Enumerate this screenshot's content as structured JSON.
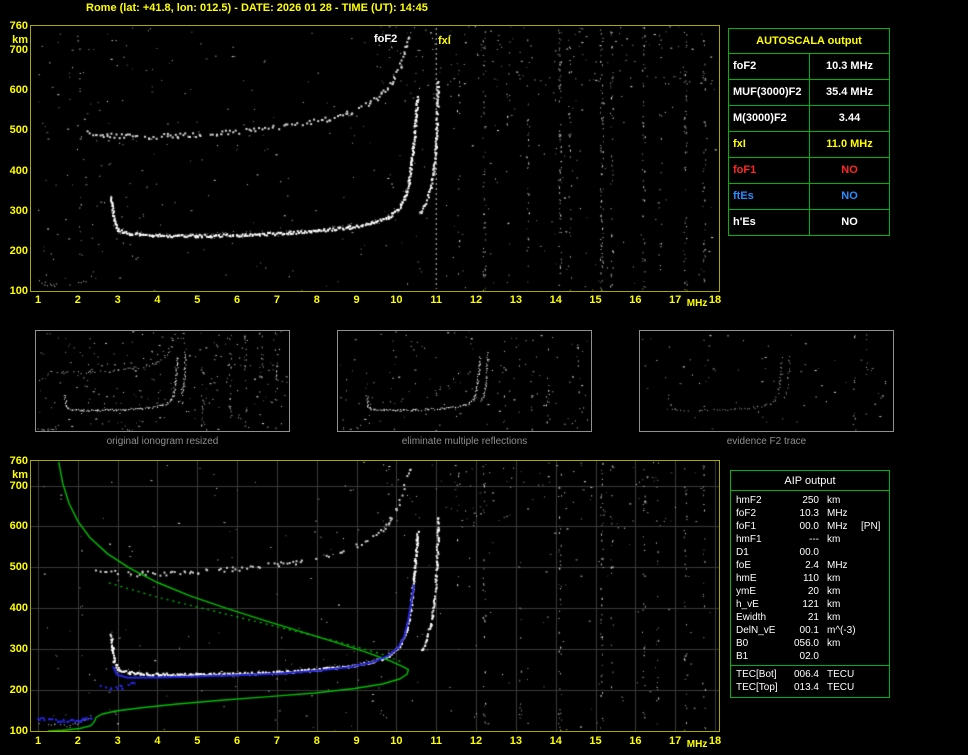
{
  "window": {
    "title": "Rome (lat: +41.8, lon: 012.5) - DATE: 2026 01 28 - TIME (UT): 14:45"
  },
  "colors": {
    "background": "#000000",
    "accent_yellow": "#ffff00",
    "plot_border_yellow": "#a8a800",
    "table_border_green": "#00b400",
    "text_white": "#ffffff",
    "alert_red": "#ff2626",
    "info_blue": "#2a8cff",
    "caption_gray": "#8f8f8f",
    "grid_gray": "#3a3a3a",
    "profile_green": "#00c000",
    "trace_blue": "#2424dd"
  },
  "axes": {
    "y_unit": "km",
    "x_unit": "MHz",
    "y_ticks": [
      760,
      700,
      600,
      500,
      400,
      300,
      200,
      100
    ],
    "x_ticks": [
      1,
      2,
      3,
      4,
      5,
      6,
      7,
      8,
      9,
      10,
      11,
      12,
      13,
      14,
      15,
      16,
      17,
      18
    ]
  },
  "top_plot": {
    "annotations": [
      {
        "label": "foF2"
      },
      {
        "label": "fxI"
      }
    ]
  },
  "autoscala": {
    "title": "AUTOSCALA output",
    "rows": [
      {
        "param": "foF2",
        "value": "10.3 MHz",
        "color": "white"
      },
      {
        "param": "MUF(3000)F2",
        "value": "35.4 MHz",
        "color": "white"
      },
      {
        "param": "M(3000)F2",
        "value": "3.44",
        "color": "white"
      },
      {
        "param": "fxI",
        "value": "11.0 MHz",
        "color": "yellow"
      },
      {
        "param": "foF1",
        "value": "NO",
        "color": "red"
      },
      {
        "param": "ftEs",
        "value": "NO",
        "color": "blue"
      },
      {
        "param": "h'Es",
        "value": "NO",
        "color": "white"
      }
    ]
  },
  "thumbnails": [
    {
      "caption": "original ionogram resized"
    },
    {
      "caption": "eliminate multiple reflections"
    },
    {
      "caption": "evidence F2 trace"
    }
  ],
  "aip": {
    "title": "AIP output",
    "rows": [
      {
        "param": "hmF2",
        "value": "250",
        "unit": "km",
        "note": ""
      },
      {
        "param": "foF2",
        "value": "10.3",
        "unit": "MHz",
        "note": ""
      },
      {
        "param": "foF1",
        "value": "00.0",
        "unit": "MHz",
        "note": "[PN]"
      },
      {
        "param": "hmF1",
        "value": "---",
        "unit": "km",
        "note": ""
      },
      {
        "param": "D1",
        "value": "00.0",
        "unit": "",
        "note": ""
      },
      {
        "param": "foE",
        "value": "2.4",
        "unit": "MHz",
        "note": ""
      },
      {
        "param": "hmE",
        "value": "110",
        "unit": "km",
        "note": ""
      },
      {
        "param": "ymE",
        "value": "20",
        "unit": "km",
        "note": ""
      },
      {
        "param": "h_vE",
        "value": "121",
        "unit": "km",
        "note": ""
      },
      {
        "param": "Ewidth",
        "value": "21",
        "unit": "km",
        "note": ""
      },
      {
        "param": "DelN_vE",
        "value": "00.1",
        "unit": "m^(-3)",
        "note": ""
      },
      {
        "param": "B0",
        "value": "056.0",
        "unit": "km",
        "note": ""
      },
      {
        "param": "B1",
        "value": "02.0",
        "unit": "",
        "note": ""
      }
    ],
    "tec_rows": [
      {
        "param": "TEC[Bot]",
        "value": "006.4",
        "unit": "TECU"
      },
      {
        "param": "TEC[Top]",
        "value": "013.4",
        "unit": "TECU"
      }
    ]
  },
  "chart_data": {
    "type": "scatter",
    "description": "Vertical-incidence ionogram (virtual height km vs frequency MHz): top = recorded ionogram with AUTOSCALA markers, middle = processing thumbnails, bottom = ionogram with restored trace (blue) and AIP electron density profile (green)",
    "x_axis": {
      "label": "MHz",
      "min": 1,
      "max": 18
    },
    "y_axis": {
      "label": "km",
      "min": 100,
      "max": 760
    },
    "parameters": {
      "foF2_MHz": 10.3,
      "MUF3000_F2_MHz": 35.4,
      "M3000_F2": 3.44,
      "fxI_MHz": 11.0,
      "foF1": "NO",
      "ftEs": "NO",
      "hpEs": "NO",
      "hmF2_km": 250,
      "foE_MHz": 2.4,
      "hmE_km": 110,
      "ymE_km": 20,
      "h_vE_km": 121,
      "Ewidth_km": 21,
      "B0_km": 56.0,
      "B1": 2.0,
      "TEC_bot_TECU": 6.4,
      "TEC_top_TECU": 13.4
    },
    "traces": {
      "f2": [
        [
          2.82,
          338
        ],
        [
          2.86,
          300
        ],
        [
          2.9,
          272
        ],
        [
          3.0,
          252
        ],
        [
          3.3,
          244
        ],
        [
          4.0,
          240
        ],
        [
          5.0,
          239
        ],
        [
          6.0,
          241
        ],
        [
          7.0,
          245
        ],
        [
          8.0,
          252
        ],
        [
          8.8,
          260
        ],
        [
          9.4,
          271
        ],
        [
          9.8,
          286
        ],
        [
          10.05,
          306
        ],
        [
          10.2,
          334
        ],
        [
          10.3,
          374
        ],
        [
          10.37,
          424
        ],
        [
          10.43,
          482
        ],
        [
          10.48,
          542
        ],
        [
          10.52,
          588
        ]
      ],
      "x_mode": [
        [
          10.6,
          296
        ],
        [
          10.73,
          322
        ],
        [
          10.84,
          358
        ],
        [
          10.92,
          404
        ],
        [
          10.97,
          458
        ],
        [
          11.0,
          516
        ],
        [
          11.02,
          572
        ],
        [
          11.03,
          622
        ]
      ],
      "multiple": [
        [
          2.25,
          498
        ],
        [
          2.7,
          490
        ],
        [
          3.5,
          486
        ],
        [
          4.5,
          489
        ],
        [
          5.5,
          495
        ],
        [
          6.5,
          503
        ],
        [
          7.5,
          516
        ],
        [
          8.3,
          531
        ],
        [
          9.0,
          553
        ],
        [
          9.5,
          582
        ],
        [
          9.85,
          621
        ],
        [
          10.08,
          664
        ],
        [
          10.22,
          708
        ],
        [
          10.3,
          745
        ]
      ],
      "e_region": [
        [
          1.03,
          122
        ],
        [
          1.4,
          114
        ],
        [
          1.8,
          114
        ],
        [
          2.15,
          123
        ],
        [
          2.32,
          140
        ]
      ],
      "blue_restored": [
        [
          2.88,
          258
        ],
        [
          2.98,
          238
        ],
        [
          3.25,
          230
        ],
        [
          4.0,
          231
        ],
        [
          5.0,
          233
        ],
        [
          6.0,
          236
        ],
        [
          7.0,
          240
        ],
        [
          8.0,
          247
        ],
        [
          8.8,
          256
        ],
        [
          9.4,
          268
        ],
        [
          9.8,
          284
        ],
        [
          10.05,
          304
        ],
        [
          10.2,
          332
        ],
        [
          10.3,
          372
        ],
        [
          10.38,
          420
        ],
        [
          10.44,
          458
        ]
      ],
      "blue_e": [
        [
          1.0,
          133
        ],
        [
          1.5,
          127
        ],
        [
          2.05,
          128
        ],
        [
          2.38,
          137
        ]
      ],
      "blue_patch": [
        [
          2.55,
          216
        ],
        [
          2.8,
          207
        ],
        [
          3.1,
          211
        ],
        [
          3.4,
          219
        ]
      ],
      "green_profile": [
        [
          1.52,
          758
        ],
        [
          1.62,
          706
        ],
        [
          1.78,
          656
        ],
        [
          2.0,
          613
        ],
        [
          2.3,
          573
        ],
        [
          2.75,
          533
        ],
        [
          3.3,
          498
        ],
        [
          4.0,
          463
        ],
        [
          4.8,
          431
        ],
        [
          5.7,
          401
        ],
        [
          6.6,
          373
        ],
        [
          7.5,
          346
        ],
        [
          8.4,
          319
        ],
        [
          9.2,
          294
        ],
        [
          9.8,
          273
        ],
        [
          10.15,
          258
        ],
        [
          10.3,
          250
        ],
        [
          10.27,
          239
        ],
        [
          10.08,
          227
        ],
        [
          9.65,
          215
        ],
        [
          8.95,
          204
        ],
        [
          7.95,
          193
        ],
        [
          6.8,
          184
        ],
        [
          5.6,
          175
        ],
        [
          4.5,
          166
        ],
        [
          3.6,
          157
        ],
        [
          2.95,
          149
        ],
        [
          2.6,
          141
        ],
        [
          2.46,
          133
        ],
        [
          2.42,
          124
        ],
        [
          2.33,
          113
        ],
        [
          2.05,
          106
        ],
        [
          1.65,
          102
        ],
        [
          1.25,
          100
        ]
      ],
      "green_dotted": [
        [
          2.78,
          462
        ],
        [
          4.0,
          427
        ],
        [
          5.5,
          391
        ],
        [
          7.0,
          355
        ],
        [
          8.5,
          319
        ],
        [
          9.6,
          289
        ],
        [
          10.18,
          267
        ]
      ]
    },
    "renders": [
      {
        "canvas": "top-canvas",
        "seed": 7,
        "inset": 7,
        "grid": false,
        "noise": [
          {
            "count": 330,
            "m": [
              1,
              18
            ],
            "km": [
              100,
              760
            ]
          },
          {
            "count": 130,
            "m": [
              9.5,
              18
            ],
            "km": [
              610,
              760
            ]
          },
          {
            "count": 50,
            "m": [
              1,
              3.4
            ],
            "km": [
              100,
              760
            ]
          }
        ],
        "columns": [
          {
            "m": 2.07,
            "c": 12
          },
          {
            "m": 11.55,
            "c": 16
          },
          {
            "m": 12.2,
            "c": 55
          },
          {
            "m": 12.8,
            "c": 14
          },
          {
            "m": 13.3,
            "c": 28
          },
          {
            "m": 14.1,
            "c": 65
          },
          {
            "m": 14.35,
            "c": 32
          },
          {
            "m": 15.15,
            "c": 80
          },
          {
            "m": 15.4,
            "c": 42
          },
          {
            "m": 16.2,
            "c": 48
          },
          {
            "m": 16.62,
            "c": 18
          },
          {
            "m": 17.25,
            "c": 52
          },
          {
            "m": 17.72,
            "c": 40
          }
        ],
        "marker": {
          "m": 11.0,
          "color": "#c8c8c8",
          "dash": [
            2,
            3
          ]
        },
        "layers": [
          {
            "trace": "multiple",
            "color": "#d8d8d8",
            "size": 2,
            "step": 2.4,
            "jx": 1.4,
            "jy": 2.4,
            "prob": 0.75
          },
          {
            "trace": "e_region",
            "color": "#cccccc",
            "size": 1,
            "step": 2.5,
            "jy": 2,
            "prob": 0.5
          },
          {
            "trace": "f2",
            "color": "#9a9a9a",
            "size": 1,
            "step": 1.6,
            "jy": 3.4,
            "prob": 0.5
          },
          {
            "trace": "f2",
            "color": "#ffffff",
            "size": 2,
            "step": 1.4,
            "jy": 1.4,
            "prob": 0.95
          },
          {
            "trace": "x_mode",
            "color": "#f2f2f2",
            "size": 2,
            "step": 1.6,
            "jy": 1.6,
            "prob": 0.9
          }
        ]
      },
      {
        "canvas": "bottom-canvas",
        "seed": 13,
        "inset": 7,
        "grid": true,
        "noise": [
          {
            "count": 240,
            "m": [
              1,
              18
            ],
            "km": [
              100,
              760
            ]
          },
          {
            "count": 80,
            "m": [
              9.5,
              18
            ],
            "km": [
              610,
              760
            ]
          }
        ],
        "columns": [
          {
            "m": 2.07,
            "c": 8
          },
          {
            "m": 11.55,
            "c": 10
          },
          {
            "m": 12.2,
            "c": 30
          },
          {
            "m": 13.1,
            "c": 16
          },
          {
            "m": 14.1,
            "c": 40
          },
          {
            "m": 15.15,
            "c": 45
          },
          {
            "m": 15.4,
            "c": 20
          },
          {
            "m": 16.2,
            "c": 26
          },
          {
            "m": 16.55,
            "c": 22
          },
          {
            "m": 17.25,
            "c": 30
          },
          {
            "m": 17.72,
            "c": 22
          }
        ],
        "layers": [
          {
            "trace": "multiple",
            "color": "#cfcfcf",
            "size": 2,
            "step": 2.6,
            "jx": 1.4,
            "jy": 2.4,
            "prob": 0.6
          },
          {
            "trace": "e_region",
            "color": "#cccccc",
            "size": 1,
            "step": 2.5,
            "jy": 2,
            "prob": 0.5
          },
          {
            "trace": "f2",
            "color": "#9a9a9a",
            "size": 1,
            "step": 1.8,
            "jy": 3.2,
            "prob": 0.45
          },
          {
            "trace": "f2",
            "color": "#ffffff",
            "size": 2,
            "step": 1.4,
            "jy": 1.3,
            "prob": 0.95
          },
          {
            "trace": "x_mode",
            "color": "#f2f2f2",
            "size": 2,
            "step": 1.6,
            "jy": 1.6,
            "prob": 0.9
          },
          {
            "trace": "green_dotted",
            "mode": "dash",
            "color": "#00c000",
            "size": 1.2,
            "dash": [
              2,
              4
            ]
          },
          {
            "trace": "green_profile",
            "mode": "line",
            "color": "#00c000",
            "size": 1.4
          },
          {
            "trace": "blue_e",
            "color": "#2828e8",
            "size": 2,
            "step": 1.6,
            "jy": 1.2,
            "prob": 0.8
          },
          {
            "trace": "blue_patch",
            "color": "#2828e8",
            "size": 2,
            "step": 2.2,
            "jy": 2.4,
            "prob": 0.6
          },
          {
            "trace": "blue_restored",
            "mode": "line",
            "color": "#2424dd",
            "size": 2
          }
        ]
      },
      {
        "canvas": "thumb1-canvas",
        "seed": 31,
        "inset": 2,
        "scale_fit": true,
        "grid": false,
        "noise": [
          {
            "count": 230,
            "m": [
              1,
              18
            ],
            "km": [
              100,
              760
            ]
          }
        ],
        "columns": [
          {
            "m": 12.2,
            "c": 14
          },
          {
            "m": 14.1,
            "c": 18
          },
          {
            "m": 15.15,
            "c": 20
          },
          {
            "m": 16.2,
            "c": 12
          },
          {
            "m": 17.25,
            "c": 14
          }
        ],
        "layers": [
          {
            "trace": "multiple",
            "color": "#c8c8c8",
            "size": 1,
            "step": 2.0,
            "jy": 1.5,
            "prob": 0.7
          },
          {
            "trace": "e_region",
            "color": "#bbbbbb",
            "size": 1,
            "step": 2.5,
            "jy": 1.2,
            "prob": 0.4
          },
          {
            "trace": "f2",
            "color": "#ffffff",
            "size": 1,
            "step": 1.2,
            "jy": 1.0,
            "prob": 0.9
          },
          {
            "trace": "x_mode",
            "color": "#e8e8e8",
            "size": 1,
            "step": 1.5,
            "jy": 1.0,
            "prob": 0.8
          }
        ]
      },
      {
        "canvas": "thumb2-canvas",
        "seed": 37,
        "inset": 2,
        "scale_fit": true,
        "grid": false,
        "noise": [
          {
            "count": 140,
            "m": [
              1,
              18
            ],
            "km": [
              100,
              760
            ]
          }
        ],
        "columns": [
          {
            "m": 12.2,
            "c": 8
          },
          {
            "m": 14.1,
            "c": 10
          },
          {
            "m": 15.15,
            "c": 12
          },
          {
            "m": 17.25,
            "c": 8
          }
        ],
        "layers": [
          {
            "trace": "e_region",
            "color": "#bbbbbb",
            "size": 1,
            "step": 2.5,
            "jy": 1.2,
            "prob": 0.4
          },
          {
            "trace": "f2",
            "color": "#ffffff",
            "size": 1,
            "step": 1.2,
            "jy": 1.0,
            "prob": 0.9
          },
          {
            "trace": "x_mode",
            "color": "#e8e8e8",
            "size": 1,
            "step": 1.5,
            "jy": 1.0,
            "prob": 0.8
          }
        ]
      },
      {
        "canvas": "thumb3-canvas",
        "seed": 41,
        "inset": 2,
        "scale_fit": true,
        "grid": false,
        "noise": [
          {
            "count": 70,
            "m": [
              1,
              18
            ],
            "km": [
              100,
              760
            ]
          }
        ],
        "columns": [
          {
            "m": 15.5,
            "c": 8
          },
          {
            "m": 16.3,
            "c": 6
          }
        ],
        "layers": [
          {
            "trace": "f2",
            "color": "#aaaaaa",
            "size": 1,
            "step": 1.6,
            "jy": 1.0,
            "prob": 0.55
          },
          {
            "trace": "x_mode",
            "color": "#999999",
            "size": 1,
            "step": 1.8,
            "jy": 1.0,
            "prob": 0.5
          }
        ]
      }
    ]
  }
}
